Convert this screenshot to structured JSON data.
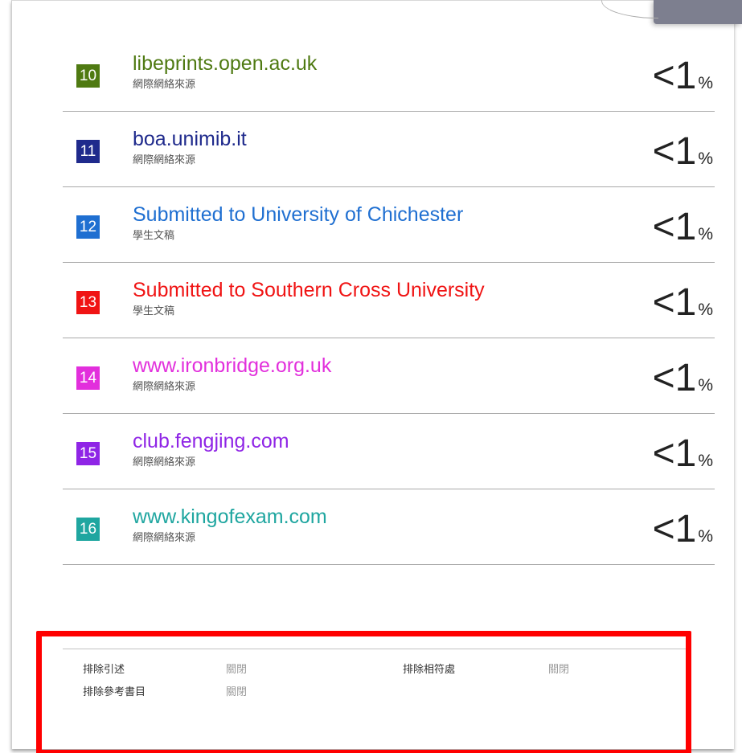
{
  "sources": [
    {
      "index": "10",
      "name": "libeprints.open.ac.uk",
      "type": "網際網絡來源",
      "percent": "<1",
      "unit": "%",
      "color": "#4f7a12"
    },
    {
      "index": "11",
      "name": "boa.unimib.it",
      "type": "網際網絡來源",
      "percent": "<1",
      "unit": "%",
      "color": "#1f2a8c"
    },
    {
      "index": "12",
      "name": "Submitted to University of Chichester",
      "type": "學生文稿",
      "percent": "<1",
      "unit": "%",
      "color": "#1f6fd1"
    },
    {
      "index": "13",
      "name": "Submitted to Southern Cross University",
      "type": "學生文稿",
      "percent": "<1",
      "unit": "%",
      "color": "#f01414"
    },
    {
      "index": "14",
      "name": "www.ironbridge.org.uk",
      "type": "網際網絡來源",
      "percent": "<1",
      "unit": "%",
      "color": "#e22fdc"
    },
    {
      "index": "15",
      "name": "club.fengjing.com",
      "type": "網際網絡來源",
      "percent": "<1",
      "unit": "%",
      "color": "#8f25e6"
    },
    {
      "index": "16",
      "name": "www.kingofexam.com",
      "type": "網際網絡來源",
      "percent": "<1",
      "unit": "%",
      "color": "#1fa6a0"
    }
  ],
  "footer": {
    "exclude_quotes_label": "排除引述",
    "exclude_quotes_value": "關閉",
    "exclude_bibliography_label": "排除參考書目",
    "exclude_bibliography_value": "關閉",
    "exclude_matches_label": "排除相符處",
    "exclude_matches_value": "關閉"
  },
  "colors": {
    "highlight_box": "#ff0000",
    "divider": "#a9a9a9"
  }
}
